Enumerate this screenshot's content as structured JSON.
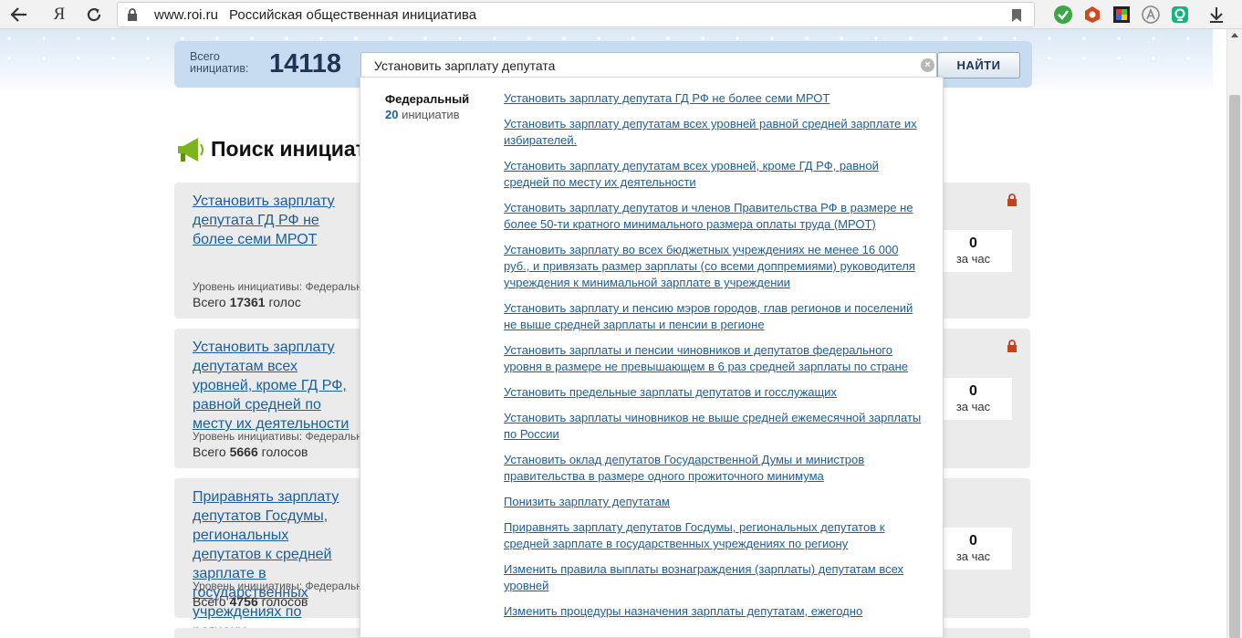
{
  "browser": {
    "back_icon": "arrow-left-icon",
    "home_label": "Я",
    "url": "www.roi.ru",
    "page_title": "Российская общественная инициатива"
  },
  "header": {
    "total_label_line1": "Всего",
    "total_label_line2": "инициатив:",
    "total_count": "14118",
    "search_value": "Установить зарплату депутата",
    "clear_symbol": "×",
    "find_label": "НАЙТИ"
  },
  "section": {
    "title": "Поиск инициатив"
  },
  "cards": [
    {
      "title": "Установить зарплату депутата ГД РФ не более семи МРОТ",
      "level": "Уровень инициативы: Федеральный",
      "votes_prefix": "Всего",
      "votes_count": "17361",
      "votes_suffix": "голос",
      "rate_value": "0",
      "rate_label": "за час"
    },
    {
      "title": "Установить зарплату депутатам всех уровней, кроме ГД РФ, равной средней по месту их деятельности",
      "level": "Уровень инициативы: Федеральный",
      "votes_prefix": "Всего",
      "votes_count": "5666",
      "votes_suffix": "голосов",
      "rate_value": "0",
      "rate_label": "за час"
    },
    {
      "title": "Приравнять зарплату депутатов Госдумы, региональных депутатов к средней зарплате в государственных учреждениях по региону",
      "level": "Уровень инициативы: Федеральный",
      "votes_prefix": "Всего",
      "votes_count": "4756",
      "votes_suffix": "голосов",
      "rate_value": "0",
      "rate_label": "за час"
    }
  ],
  "dropdown": {
    "category": "Федеральный",
    "count": "20",
    "count_suffix": "инициатив",
    "items": [
      "Установить зарплату депутата ГД РФ не более семи МРОТ",
      "Установить зарплату депутатам всех уровней равной средней зарплате их избирателей.",
      "Установить зарплату депутатам всех уровней, кроме ГД РФ, равной средней по месту их деятельности",
      "Установить зарплату депутатов и членов Правительства РФ в размере не более 50-ти кратного минимального размера оплаты труда (МРОТ)",
      "Установить зарплату во всех бюджетных учреждениях не менее 16 000 руб., и привязать размер зарплаты (со всеми доппремиями) руководителя учреждения к минимальной зарплате в учреждении",
      "Установить зарплату и пенсию мэров городов, глав регионов и поселений не выше средней зарплаты и пенсии в регионе",
      "Установить зарплаты и пенсии чиновников и депутатов федерального уровня в размере не превышающем в 6 раз средней зарплаты по стране",
      "Установить предельные зарплаты депутатов и госслужащих",
      "Установить зарплаты чиновников не выше средней ежемесячной зарплаты по России",
      "Установить оклад депутатов Государственной Думы и министров правительства в размере одного прожиточного минимума",
      "Понизить зарплату депутатам",
      "Приравнять зарплату депутатов Госдумы, региональных депутатов к средней зарплате в государственных учреждениях по региону",
      "Изменить правила выплаты вознаграждения (зарплаты) депутатам всех уровней",
      "Изменить процедуры назначения зарплаты депутатам, ежегодно"
    ]
  }
}
